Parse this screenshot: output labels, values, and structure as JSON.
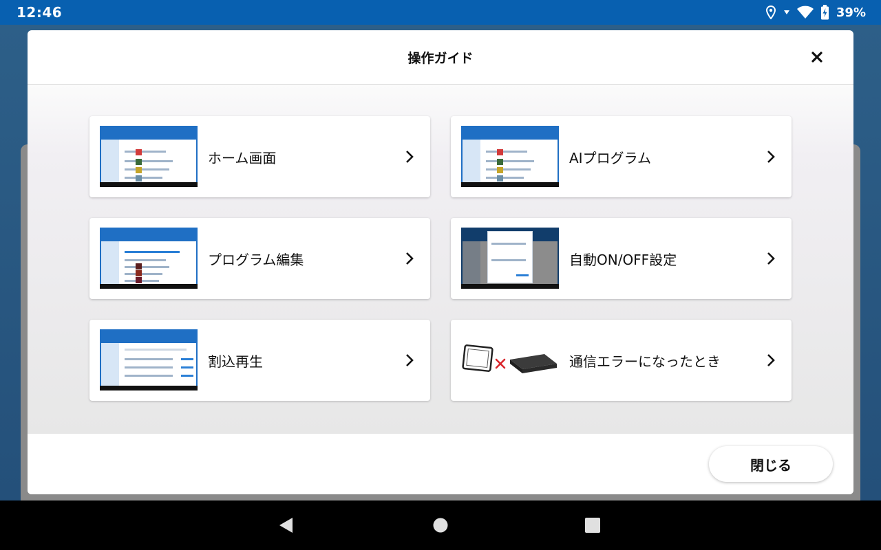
{
  "status_bar": {
    "time": "12:46",
    "battery": "39%",
    "icons": [
      "location-icon",
      "wifi-icon",
      "battery-charging-icon"
    ]
  },
  "dialog": {
    "title": "操作ガイド",
    "close_icon": "close-icon",
    "items": [
      {
        "label": "ホーム画面",
        "thumb": "home-screen-thumbnail"
      },
      {
        "label": "AIプログラム",
        "thumb": "ai-program-thumbnail"
      },
      {
        "label": "プログラム編集",
        "thumb": "program-edit-thumbnail"
      },
      {
        "label": "自動ON/OFF設定",
        "thumb": "auto-onoff-thumbnail"
      },
      {
        "label": "割込再生",
        "thumb": "interrupt-play-thumbnail"
      },
      {
        "label": "通信エラーになったとき",
        "thumb": "tablet-x-device-illustration"
      }
    ],
    "close_button": "閉じる"
  },
  "nav": {
    "back": "back-icon",
    "home": "home-icon",
    "recents": "recents-icon"
  },
  "colors": {
    "status_bar": "#0860b0",
    "accent": "#1f6fc4",
    "error_x": "#d9262c"
  }
}
